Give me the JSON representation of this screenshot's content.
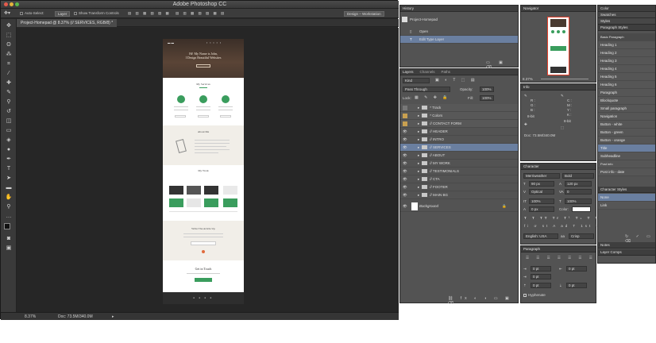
{
  "window": {
    "title": "Adobe Photoshop CC"
  },
  "options": {
    "auto_select": "Auto-Select:",
    "layer_mode": "Layer",
    "show_transform": "Show Transform Controls",
    "workspace": "Design – Workstation"
  },
  "document": {
    "tab": "Project-Homepad @ 8.37% (// SERVICES, RGB/8) *",
    "zoom": "8.37%",
    "doc_size": "Doc: 73.5M/340.0M",
    "hero_line1": "Hi! My Name is John,",
    "hero_line2": "I Design Beautiful Websites",
    "services_title": "My Services",
    "about_title": "About Me",
    "work_title": "My Work",
    "cta_title": "Write The Article Up",
    "touch_title": "Get in Touch"
  },
  "history": {
    "title": "History",
    "snapshot": "Project-Homepad",
    "items": [
      "Open",
      "Edit Type Layer"
    ]
  },
  "navigator": {
    "title": "Navigator",
    "zoom": "8.37%"
  },
  "info": {
    "title": "Info",
    "r": "R :",
    "g": "G :",
    "b": "B :",
    "bit": "8-bit",
    "c": "C :",
    "m": "M :",
    "y": "Y :",
    "k": "K :",
    "doc": "Doc: 73.5M/340.0M"
  },
  "layers": {
    "tabs": [
      "Layers",
      "Channels",
      "Paths"
    ],
    "kind": "Kind",
    "blend": "Pass Through",
    "opacity_label": "Opacity:",
    "opacity": "100%",
    "lock_label": "Lock:",
    "fill_label": "Fill:",
    "fill": "100%",
    "items": [
      "* Track",
      "* Colors",
      "// CONTACT FORM",
      "// HEADER",
      "// INTRO",
      "// SERVICES",
      "// ABOUT",
      "// MY WORK",
      "// TESTIMONIALS",
      "// CTA",
      "// FOOTER",
      "// MAIN BG",
      "Background"
    ]
  },
  "character": {
    "title": "Character",
    "font": "Merriweather",
    "weight": "Bold",
    "size": "90 px",
    "leading": "120 px",
    "kerning": "Optical",
    "tracking": "0",
    "vscale": "100%",
    "hscale": "100%",
    "baseline": "0 px",
    "color_label": "Color:",
    "language": "English: USA",
    "aa": "Crisp"
  },
  "paragraph": {
    "title": "Paragraph",
    "indent_left": "0 pt",
    "indent_right": "0 pt",
    "first_line": "0 pt",
    "space_before": "0 pt",
    "space_after": "0 pt",
    "hyphenate": "Hyphenate"
  },
  "color": {
    "title": "Color",
    "swatches": "Swatches",
    "styles": "Styles"
  },
  "para_styles": {
    "title": "Paragraph Styles",
    "items": [
      "Basic Paragraph",
      "Heading 1",
      "Heading 2",
      "Heading 3",
      "Heading 4",
      "Heading 5",
      "Heading 6",
      "Paragraph",
      "Blockquote",
      "Small paragraph",
      "Navigation",
      "Button - white",
      "Button - green",
      "Button - orange",
      "Title",
      "Subheadline",
      "Post info",
      "Post info - date"
    ]
  },
  "char_styles": {
    "title": "Character Styles",
    "items": [
      "None",
      "Link"
    ]
  },
  "notes": {
    "title": "Notes",
    "layer_comps": "Layer Comps"
  },
  "colors": {
    "green": "#3a9d5d",
    "selection": "#6a7fa0",
    "nav_frame": "#e8412b"
  }
}
